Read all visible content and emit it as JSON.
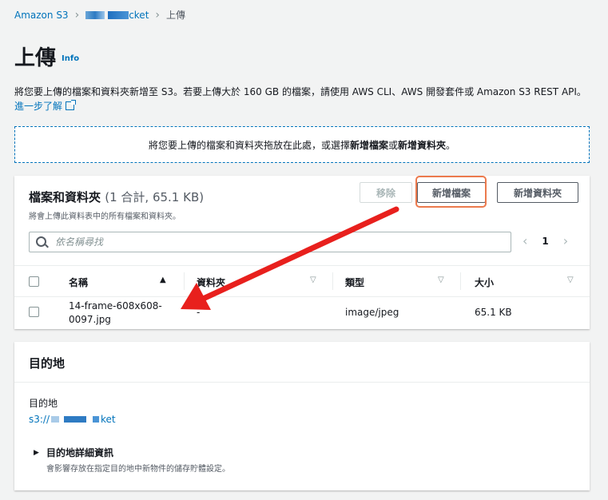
{
  "breadcrumb": {
    "root": "Amazon S3",
    "bucket_suffix": "cket",
    "current": "上傳"
  },
  "header": {
    "title": "上傳",
    "info": "Info"
  },
  "description": {
    "text": "將您要上傳的檔案和資料夾新增至 S3。若要上傳大於 160 GB 的檔案，請使用 AWS CLI、AWS 開發套件或 Amazon S3 REST API。",
    "learn_more": "進一步了解"
  },
  "dropzone": {
    "prefix": "將您要上傳的檔案和資料夾拖放在此處，或選擇",
    "add_files": "新增檔案",
    "or": "或",
    "add_folder": "新增資料夾",
    "suffix": "。"
  },
  "files_panel": {
    "title": "檔案和資料夾",
    "count": "(1 合計, 65.1 KB)",
    "subtitle": "將會上傳此資料表中的所有檔案和資料夾。",
    "remove_button": "移除",
    "add_files_button": "新增檔案",
    "add_folder_button": "新增資料夾",
    "search_placeholder": "依名稱尋找",
    "page_number": "1",
    "columns": [
      "名稱",
      "資料夾",
      "類型",
      "大小"
    ],
    "rows": [
      {
        "name_line1": "14-frame-608x608-",
        "name_line2": "0097.jpg",
        "folder": "-",
        "type": "image/jpeg",
        "size": "65.1 KB"
      }
    ]
  },
  "destination": {
    "title": "目的地",
    "label": "目的地",
    "url_prefix": "s3://",
    "url_suffix": "ket",
    "details_title": "目的地詳細資訊",
    "details_subtitle": "會影響存放在指定目的地中新物件的儲存貯體設定。"
  },
  "colors": {
    "link": "#0073bb",
    "highlight": "#ec7a4d",
    "annotation_arrow": "#e8201d"
  },
  "icons": [
    "chevron-right-icon",
    "external-link-icon",
    "search-icon",
    "chevron-left-icon",
    "sort-ascending-icon",
    "sort-descending-icon",
    "caret-right-icon"
  ]
}
